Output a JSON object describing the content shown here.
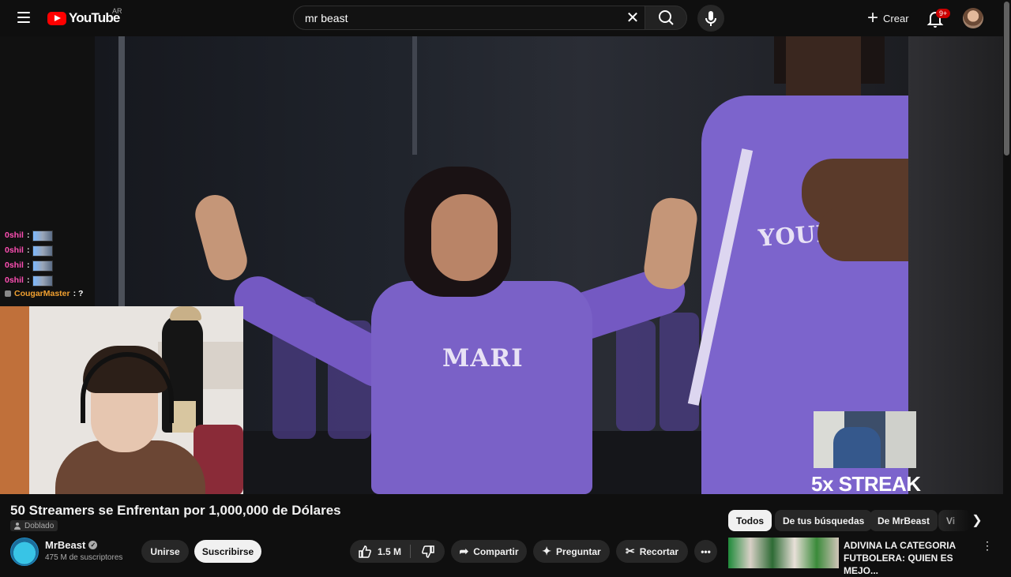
{
  "header": {
    "logo_text": "YouTube",
    "country_code": "AR",
    "search_value": "mr beast",
    "create_label": "Crear",
    "notifications_badge": "9+"
  },
  "video": {
    "overlay_chat": [
      {
        "user": "0shil",
        "sep": " :",
        "emote": true
      },
      {
        "user": "0shil",
        "sep": " :",
        "emote": true
      },
      {
        "user": "0shil",
        "sep": " :",
        "emote": true
      },
      {
        "user": "0shil",
        "sep": " :",
        "emote": true
      },
      {
        "user": "CougarMaster",
        "sep": " : ?",
        "emote": false
      }
    ],
    "shirt_text_left": "MARI",
    "shirt_text_right": "YOURRAGE",
    "streak_text": "5x STREAK"
  },
  "watch": {
    "title": "50 Streamers se Enfrentan por 1,000,000 de Dólares",
    "dub_badge": "Doblado",
    "channel_name": "MrBeast",
    "subscribers": "475 M de suscriptores",
    "join_label": "Unirse",
    "subscribe_label": "Suscribirse",
    "like_count": "1.5 M",
    "share_label": "Compartir",
    "ask_label": "Preguntar",
    "clip_label": "Recortar"
  },
  "related": {
    "chips": [
      "Todos",
      "De tus búsquedas",
      "De MrBeast",
      "Vi"
    ],
    "active_chip": "Todos",
    "first_item_title": "ADIVINA LA CATEGORIA FUTBOLERA: QUIEN ES MEJO..."
  },
  "colors": {
    "background": "#0f0f0f",
    "brand_red": "#ff0000",
    "pill_dark": "#272727",
    "chat_user_pink": "#ff4fb4",
    "chat_user_orange": "#f0a030"
  }
}
